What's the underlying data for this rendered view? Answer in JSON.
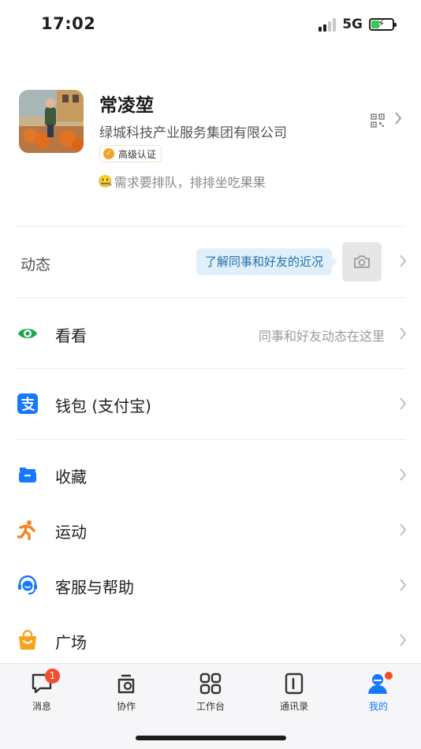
{
  "status_bar": {
    "time": "17:02",
    "network": "5G",
    "battery_level": 0.4
  },
  "profile": {
    "name": "常凌堃",
    "company": "绿城科技产业服务集团有限公司",
    "badge": "高级认证",
    "signature_emoji": "🤐",
    "signature": "需求要排队，排排坐吃果果"
  },
  "moments": {
    "label": "动态",
    "hint": "了解同事和好友的近况"
  },
  "menu": {
    "look": {
      "label": "看看",
      "hint": "同事和好友动态在这里"
    },
    "wallet": {
      "label": "钱包 (支付宝)"
    },
    "favorites": {
      "label": "收藏"
    },
    "sport": {
      "label": "运动"
    },
    "help": {
      "label": "客服与帮助"
    },
    "square": {
      "label": "广场"
    }
  },
  "tabbar": {
    "messages": {
      "label": "消息",
      "badge": "1"
    },
    "collab": {
      "label": "协作"
    },
    "workbench": {
      "label": "工作台"
    },
    "contacts": {
      "label": "通讯录"
    },
    "me": {
      "label": "我的"
    }
  },
  "colors": {
    "accent": "#1677ff",
    "badge_red": "#f24e2e",
    "look_green": "#1aa64a",
    "sport_orange": "#f5821f",
    "square_orange": "#f7a21a"
  }
}
